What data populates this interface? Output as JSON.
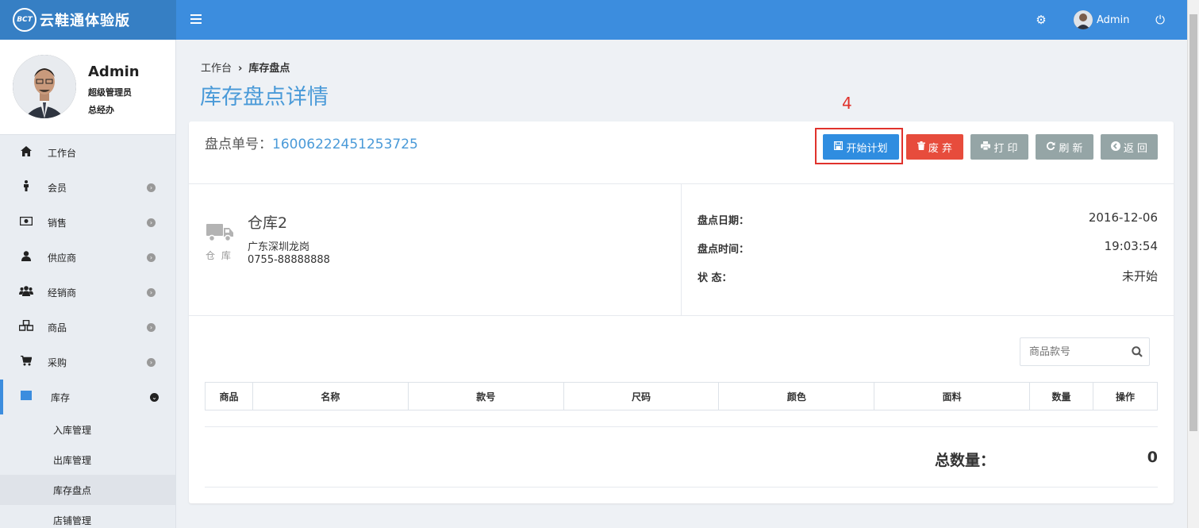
{
  "brand": {
    "logo_text": "BCT",
    "name": "云鞋通体验版"
  },
  "topbar": {
    "user_name": "Admin"
  },
  "user": {
    "name": "Admin",
    "role": "超级管理员",
    "dept": "总经办"
  },
  "sidebar": {
    "items": [
      {
        "label": "工作台",
        "icon": "home-icon"
      },
      {
        "label": "会员",
        "icon": "person-icon"
      },
      {
        "label": "销售",
        "icon": "money-icon"
      },
      {
        "label": "供应商",
        "icon": "user-icon"
      },
      {
        "label": "经销商",
        "icon": "users-icon"
      },
      {
        "label": "商品",
        "icon": "cubes-icon"
      },
      {
        "label": "采购",
        "icon": "cart-icon"
      },
      {
        "label": "库存",
        "icon": "inventory-icon"
      }
    ],
    "sub_items": [
      "入库管理",
      "出库管理",
      "库存盘点",
      "店铺管理"
    ]
  },
  "breadcrumb": {
    "home": "工作台",
    "current": "库存盘点"
  },
  "page": {
    "title": "库存盘点详情",
    "annotation": "4"
  },
  "order": {
    "label": "盘点单号：",
    "number": "16006222451253725"
  },
  "buttons": {
    "start": "开始计划",
    "discard": "废 弃",
    "print": "打 印",
    "refresh": "刷 新",
    "back": "返 回"
  },
  "warehouse": {
    "icon_label": "仓 库",
    "name": "仓库2",
    "address": "广东深圳龙岗",
    "phone": "0755-88888888"
  },
  "info": [
    {
      "label": "盘点日期：",
      "value": "2016-12-06"
    },
    {
      "label": "盘点时间：",
      "value": "19:03:54"
    },
    {
      "label": "状 态：",
      "value": "未开始"
    }
  ],
  "search": {
    "placeholder": "商品款号"
  },
  "table": {
    "headers": [
      "商品",
      "名称",
      "款号",
      "尺码",
      "颜色",
      "面料",
      "数量",
      "操作"
    ]
  },
  "total": {
    "label": "总数量：",
    "value": "0"
  },
  "colors": {
    "primary": "#3c8dde",
    "danger": "#e74c3c",
    "gray": "#95a5a6",
    "accent_title": "#4a9ad8"
  }
}
